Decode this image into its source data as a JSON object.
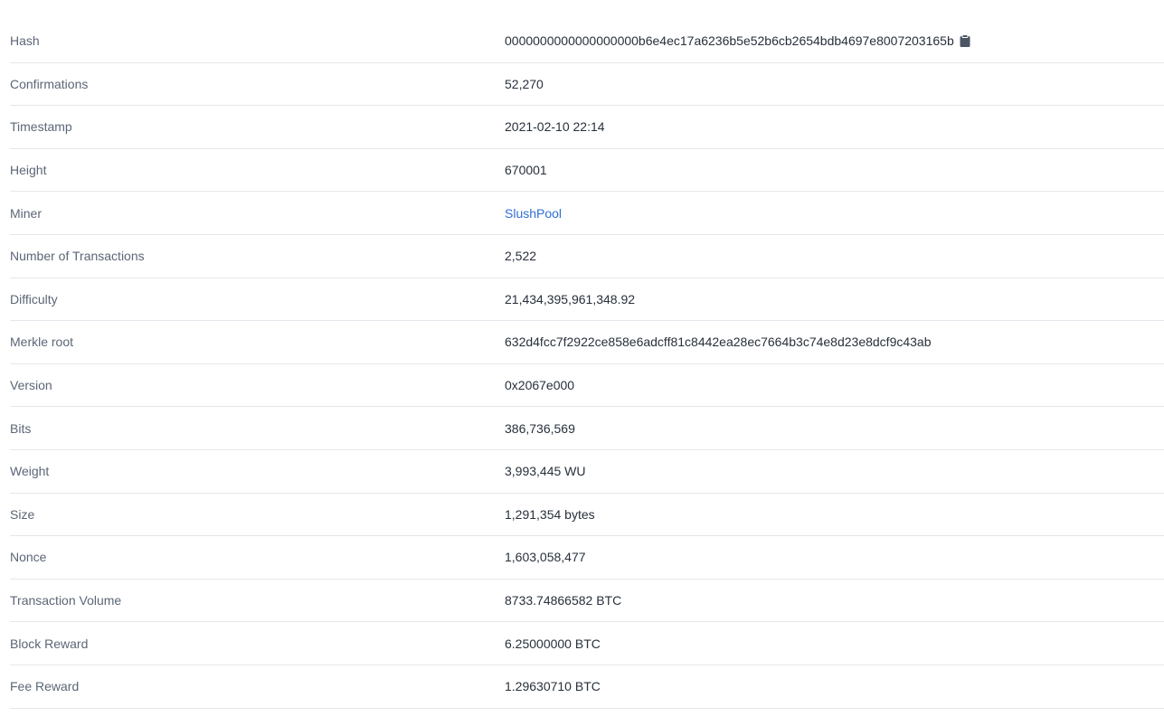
{
  "block": {
    "rows": [
      {
        "label": "Hash",
        "value": "0000000000000000000b6e4ec17a6236b5e52b6cb2654bdb4697e8007203165b"
      },
      {
        "label": "Confirmations",
        "value": "52,270"
      },
      {
        "label": "Timestamp",
        "value": "2021-02-10 22:14"
      },
      {
        "label": "Height",
        "value": "670001"
      },
      {
        "label": "Miner",
        "value": "SlushPool"
      },
      {
        "label": "Number of Transactions",
        "value": "2,522"
      },
      {
        "label": "Difficulty",
        "value": "21,434,395,961,348.92"
      },
      {
        "label": "Merkle root",
        "value": "632d4fcc7f2922ce858e6adcff81c8442ea28ec7664b3c74e8d23e8dcf9c43ab"
      },
      {
        "label": "Version",
        "value": "0x2067e000"
      },
      {
        "label": "Bits",
        "value": "386,736,569"
      },
      {
        "label": "Weight",
        "value": "3,993,445 WU"
      },
      {
        "label": "Size",
        "value": "1,291,354 bytes"
      },
      {
        "label": "Nonce",
        "value": "1,603,058,477"
      },
      {
        "label": "Transaction Volume",
        "value": "8733.74866582 BTC"
      },
      {
        "label": "Block Reward",
        "value": "6.25000000 BTC"
      },
      {
        "label": "Fee Reward",
        "value": "1.29630710 BTC"
      }
    ]
  },
  "icons": {
    "copy": "clipboard-icon"
  },
  "colors": {
    "link": "#2f6fd1",
    "label": "#5b6676",
    "value": "#27303b",
    "divider": "#e4e7eb"
  }
}
